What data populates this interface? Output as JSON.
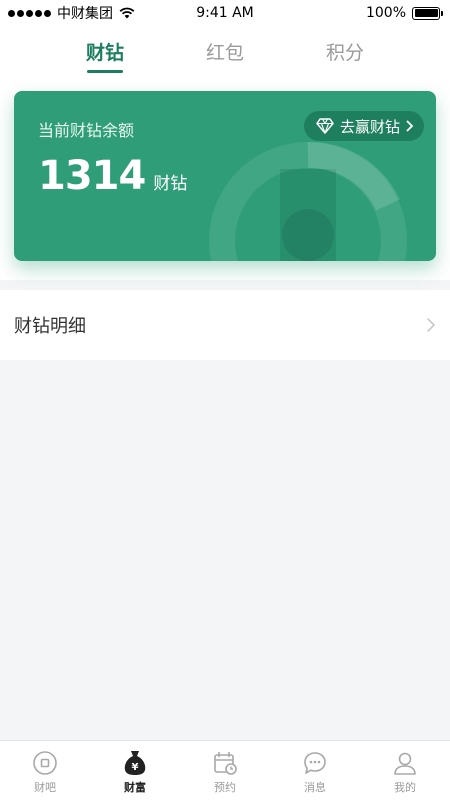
{
  "status_bar": {
    "carrier": "中财集团",
    "time": "9:41 AM",
    "battery": "100%"
  },
  "tabs": [
    {
      "label": "财钻",
      "active": true
    },
    {
      "label": "红包",
      "active": false
    },
    {
      "label": "积分",
      "active": false
    }
  ],
  "balance_card": {
    "label": "当前财钻余额",
    "amount": "1314",
    "unit": "财钻",
    "earn_button": "去赢财钻",
    "earn_icon": "diamond-icon",
    "background_color": "#2f9e78"
  },
  "detail_row": {
    "label": "财钻明细",
    "icon": "chevron-right-icon"
  },
  "bottom_nav": [
    {
      "label": "财吧",
      "icon": "coin-icon",
      "active": false
    },
    {
      "label": "财富",
      "icon": "money-bag-icon",
      "active": true
    },
    {
      "label": "预约",
      "icon": "calendar-icon",
      "active": false
    },
    {
      "label": "消息",
      "icon": "chat-bubble-icon",
      "active": false
    },
    {
      "label": "我的",
      "icon": "user-icon",
      "active": false
    }
  ],
  "colors": {
    "accent": "#1d7d5f",
    "card": "#2f9e78",
    "inactive": "#9a9a9a"
  }
}
